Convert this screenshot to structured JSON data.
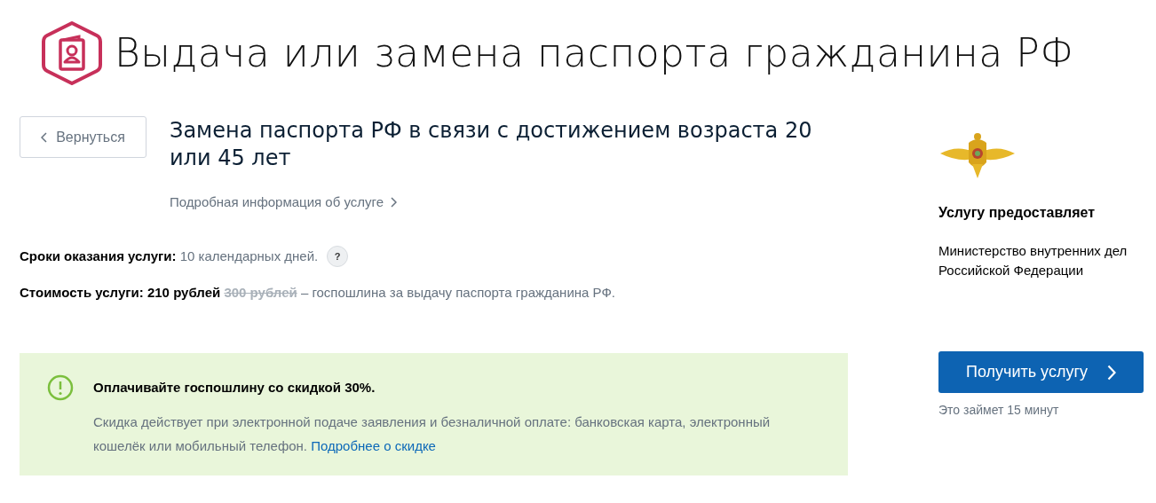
{
  "page_title": "Выдача или замена паспорта гражданина РФ",
  "back_button": {
    "label": "Вернуться"
  },
  "service": {
    "title": "Замена паспорта РФ в связи с достижением возраста 20 или 45 лет",
    "details_link": "Подробная информация об услуге"
  },
  "term": {
    "label": "Сроки оказания услуги:",
    "value": "10 календарных дней.",
    "help": "?"
  },
  "cost": {
    "label": "Стоимость услуги:",
    "price": "210 рублей",
    "old_price": "300 рублей",
    "note": "– госпошлина за выдачу паспорта гражданина РФ."
  },
  "notice": {
    "title": "Оплачивайте госпошлину со скидкой 30%.",
    "text": "Скидка действует при электронной подаче заявления и безналичной оплате: банковская карта, электронный кошелёк или мобильный телефон.",
    "link": "Подробнее о скидке"
  },
  "provider": {
    "heading": "Услугу предоставляет",
    "name": "Министерство внутренних дел Российской Федерации"
  },
  "action": {
    "button": "Получить услугу",
    "note": "Это займет 15 минут"
  }
}
